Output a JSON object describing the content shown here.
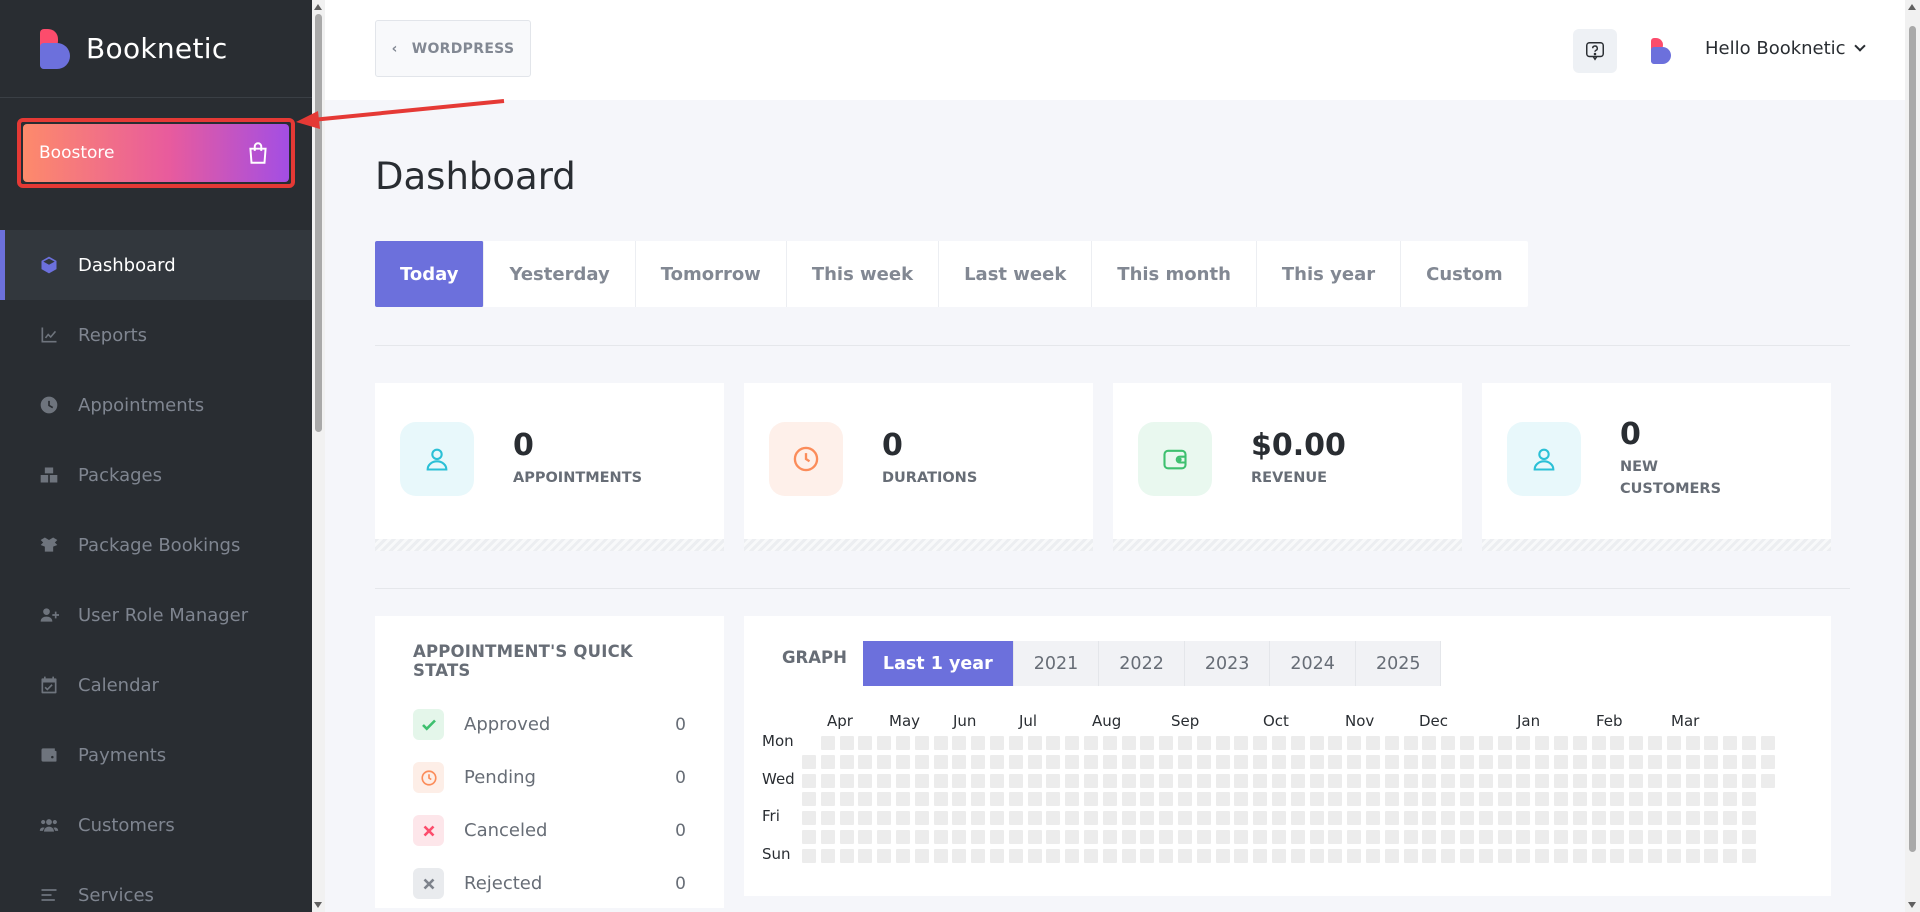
{
  "brand": {
    "name": "Booknetic"
  },
  "boostore": {
    "label": "Boostore"
  },
  "sidebar": {
    "items": [
      {
        "label": "Dashboard",
        "icon": "cube-icon",
        "active": true
      },
      {
        "label": "Reports",
        "icon": "chart-line-icon"
      },
      {
        "label": "Appointments",
        "icon": "clock-icon"
      },
      {
        "label": "Packages",
        "icon": "boxes-icon"
      },
      {
        "label": "Package Bookings",
        "icon": "box-open-icon"
      },
      {
        "label": "User Role Manager",
        "icon": "user-plus-icon"
      },
      {
        "label": "Calendar",
        "icon": "calendar-icon"
      },
      {
        "label": "Payments",
        "icon": "wallet-icon"
      },
      {
        "label": "Customers",
        "icon": "users-icon"
      },
      {
        "label": "Services",
        "icon": "list-icon"
      }
    ]
  },
  "header": {
    "back_label": "WORDPRESS",
    "user_greeting": "Hello Booknetic"
  },
  "page": {
    "title": "Dashboard"
  },
  "filters": {
    "tabs": [
      "Today",
      "Yesterday",
      "Tomorrow",
      "This week",
      "Last week",
      "This month",
      "This year",
      "Custom"
    ],
    "active": "Today"
  },
  "stats": [
    {
      "value": "0",
      "label": "APPOINTMENTS",
      "icon": "user-icon",
      "color": "#2bc0d6",
      "bg": "#e8f8fb"
    },
    {
      "value": "0",
      "label": "DURATIONS",
      "icon": "clock-icon",
      "color": "#fb8c5a",
      "bg": "#fef0ea"
    },
    {
      "value": "$0.00",
      "label": "REVENUE",
      "icon": "wallet-icon",
      "color": "#3ec06f",
      "bg": "#e9f8ef"
    },
    {
      "value": "0",
      "label": "NEW CUSTOMERS",
      "icon": "user-icon",
      "color": "#2bc0d6",
      "bg": "#e8f8fb"
    }
  ],
  "quick_stats": {
    "title": "APPOINTMENT'S QUICK STATS",
    "rows": [
      {
        "label": "Approved",
        "value": "0",
        "icon": "check-icon",
        "color": "#3ec06f",
        "bg": "#e4f6ea"
      },
      {
        "label": "Pending",
        "value": "0",
        "icon": "clock-icon",
        "color": "#fb8c5a",
        "bg": "#fdeee7"
      },
      {
        "label": "Canceled",
        "value": "0",
        "icon": "times-icon",
        "color": "#fc4c6c",
        "bg": "#fde6ea"
      },
      {
        "label": "Rejected",
        "value": "0",
        "icon": "times-icon",
        "color": "#7d828b",
        "bg": "#e9ebee"
      }
    ]
  },
  "graph": {
    "title": "GRAPH",
    "tabs": [
      "Last 1 year",
      "2021",
      "2022",
      "2023",
      "2024",
      "2025"
    ],
    "active": "Last 1 year",
    "months": [
      "Apr",
      "May",
      "Jun",
      "Jul",
      "Aug",
      "Sep",
      "Oct",
      "Nov",
      "Dec",
      "Jan",
      "Feb",
      "Mar"
    ],
    "day_labels": [
      "Mon",
      "Wed",
      "Fri",
      "Sun"
    ]
  },
  "colors": {
    "accent": "#6c70dc",
    "sidebar_bg": "#292d32",
    "brand_red": "#fc4c6c"
  }
}
